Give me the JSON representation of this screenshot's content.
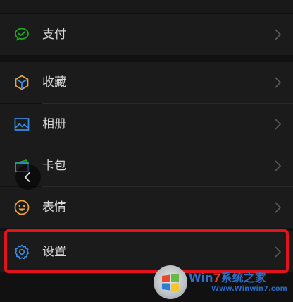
{
  "menu": {
    "pay": {
      "label": "支付",
      "icon": "wechat-pay-icon",
      "color": "#1aad19"
    },
    "favorites": {
      "label": "收藏",
      "icon": "cube-icon",
      "color": "#f0a43a"
    },
    "album": {
      "label": "相册",
      "icon": "image-icon",
      "color": "#3b8fe8"
    },
    "cards": {
      "label": "卡包",
      "icon": "card-wallet-icon",
      "color": "#3b8fe8"
    },
    "stickers": {
      "label": "表情",
      "icon": "smiley-icon",
      "color": "#f0a43a"
    },
    "settings": {
      "label": "设置",
      "icon": "gear-icon",
      "color": "#3b8fe8"
    }
  },
  "overlay": {
    "back_icon": "chevron-left-icon",
    "highlight_color": "#e1141b"
  },
  "watermark": {
    "brand_prefix": "Win",
    "brand_seven": "7",
    "brand_suffix": "系统之家",
    "url": "Www.Winwin7.com"
  }
}
